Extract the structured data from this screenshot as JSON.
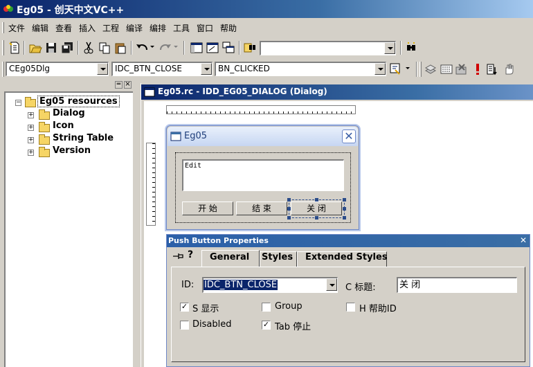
{
  "app": {
    "title": "Eg05 - 创天中文VC++"
  },
  "menu": [
    "文件",
    "编辑",
    "查看",
    "插入",
    "工程",
    "编译",
    "编排",
    "工具",
    "窗口",
    "帮助"
  ],
  "toolbar1": {
    "icons": [
      "new-file-icon",
      "open-icon",
      "save-icon",
      "save-all-icon",
      "cut-icon",
      "copy-icon",
      "paste-icon",
      "undo-icon",
      "redo-icon",
      "workspace-icon",
      "output-icon",
      "window-list-icon",
      "find-in-files-icon",
      "find-icon"
    ],
    "find_value": ""
  },
  "wizardbar": {
    "class_value": "CEg05Dlg",
    "id_value": "IDC_BTN_CLOSE",
    "message_value": "BN_CLICKED"
  },
  "workspace": {
    "root": "Eg05 resources",
    "items": [
      "Dialog",
      "Icon",
      "String Table",
      "Version"
    ]
  },
  "editor": {
    "title": "Eg05.rc - IDD_EG05_DIALOG (Dialog)"
  },
  "dialog_preview": {
    "title": "Eg05",
    "edit_text": "Edit",
    "buttons": [
      "开 始",
      "结 束",
      "关 闭"
    ]
  },
  "properties": {
    "title": "Push Button Properties",
    "tabs": [
      "General",
      "Styles",
      "Extended Styles"
    ],
    "id_label": "ID:",
    "id_value": "IDC_BTN_CLOSE",
    "caption_label": "C 标题:",
    "caption_value": "关 闭",
    "checks": [
      {
        "label": "S 显示",
        "checked": true
      },
      {
        "label": "Group",
        "checked": false
      },
      {
        "label": "H 帮助ID",
        "checked": false
      },
      {
        "label": "Disabled",
        "checked": false
      },
      {
        "label": "Tab 停止",
        "checked": true
      }
    ]
  }
}
